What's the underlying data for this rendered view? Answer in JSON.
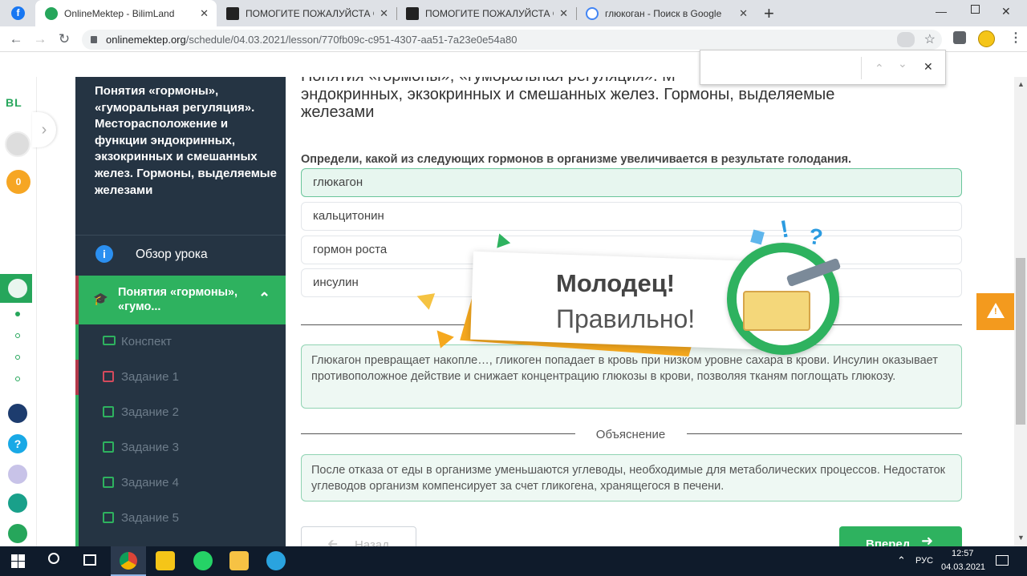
{
  "browser": {
    "tabs": [
      {
        "title": "OnlineMektep - BilimLand",
        "active": true
      },
      {
        "title": "ПОМОГИТЕ ПОЖАЛУЙСТА Опр",
        "active": false
      },
      {
        "title": "ПОМОГИТЕ ПОЖАЛУЙСТА Опр",
        "active": false
      },
      {
        "title": "глюкоган - Поиск в Google",
        "active": false
      }
    ],
    "new_tab": "+",
    "url_domain": "onlinemektep.org",
    "url_path": "/schedule/04.03.2021/lesson/770fb09c-c951-4307-aa51-7a23e0e54a80",
    "find_controls": {
      "up": "⌃",
      "down": "⌄",
      "close": "✕"
    }
  },
  "rail": {
    "logo": "BL",
    "points": "0"
  },
  "sidebar": {
    "lesson_title": "Понятия «гормоны», «гуморальная регуляция». Месторасположение и функции эндокринных, экзокринных и смешанных желез. Гормоны, выделяемые железами",
    "overview": "Обзор урока",
    "section": "Понятия «гормоны», «гумо...",
    "items": [
      "Конспект",
      "Задание 1",
      "Задание 2",
      "Задание 3",
      "Задание 4",
      "Задание 5"
    ]
  },
  "main": {
    "heading_top": "Понятия «гормоны», «гуморальная регуляция». М",
    "heading_rest": "эндокринных, экзокринных и смешанных желез. Гормоны, выделяемые железами",
    "question": "Определи, какой из следующих гормонов в организме увеличивается в результате голодания.",
    "options": [
      "глюкагон",
      "кальцитонин",
      "гормон роста",
      "инсулин"
    ],
    "feedback_text": "Глюкагон превращает накопле…, гликоген попадает в кровь при низком уровне сахара в крови. Инсулин оказывает противоположное действие и снижает концентрацию глюкозы в крови, позволяя тканям поглощать глюкозу.",
    "explanation_label": "Объяснение",
    "explanation_text": "После отказа от еды в организме уменьшаются углеводы, необходимые для метаболических процессов. Недостаток углеводов организм компенсирует за счет гликогена, хранящегося в печени.",
    "back_button": "Назад",
    "next_button": "Вперед"
  },
  "popup": {
    "title": "Молодец!",
    "subtitle": "Правильно!",
    "deco": [
      "!",
      "?"
    ]
  },
  "taskbar": {
    "lang": "РУС",
    "time": "12:57",
    "date": "04.03.2021"
  }
}
